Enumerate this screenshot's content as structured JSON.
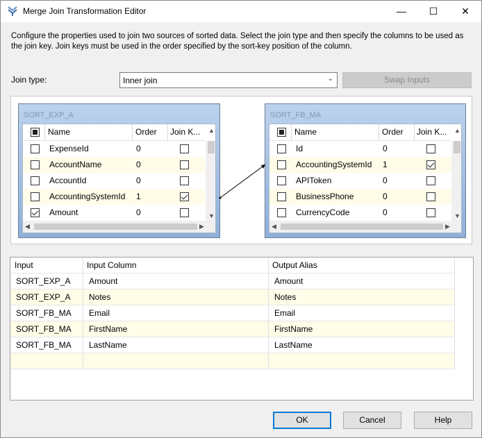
{
  "window": {
    "title": "Merge Join Transformation Editor",
    "minimize": "—",
    "maximize": "☐",
    "close": "✕"
  },
  "description": "Configure the properties used to join two sources of sorted data. Select the join type and then specify the columns to be used as the join key. Join keys must be used in the order specified by the sort-key position of the column.",
  "join": {
    "label": "Join type:",
    "selected": "Inner join",
    "swap_label": "Swap Inputs"
  },
  "left_source": {
    "name": "SORT_EXP_A",
    "columns": [
      "Name",
      "Order",
      "Join K..."
    ],
    "rows": [
      {
        "name": "ExpenseId",
        "order": "0",
        "selected": false,
        "join_key": false
      },
      {
        "name": "AccountName",
        "order": "0",
        "selected": false,
        "join_key": false
      },
      {
        "name": "AccountId",
        "order": "0",
        "selected": false,
        "join_key": false
      },
      {
        "name": "AccountingSystemId",
        "order": "1",
        "selected": false,
        "join_key": true
      },
      {
        "name": "Amount",
        "order": "0",
        "selected": true,
        "join_key": false
      }
    ]
  },
  "right_source": {
    "name": "SORT_FB_MA",
    "columns": [
      "Name",
      "Order",
      "Join K..."
    ],
    "rows": [
      {
        "name": "Id",
        "order": "0",
        "selected": false,
        "join_key": false
      },
      {
        "name": "AccountingSystemId",
        "order": "1",
        "selected": false,
        "join_key": true
      },
      {
        "name": "APIToken",
        "order": "0",
        "selected": false,
        "join_key": false
      },
      {
        "name": "BusinessPhone",
        "order": "0",
        "selected": false,
        "join_key": false
      },
      {
        "name": "CurrencyCode",
        "order": "0",
        "selected": false,
        "join_key": false
      }
    ]
  },
  "output": {
    "headers": [
      "Input",
      "Input Column",
      "Output Alias"
    ],
    "rows": [
      [
        "SORT_EXP_A",
        "Amount",
        "Amount"
      ],
      [
        "SORT_EXP_A",
        "Notes",
        "Notes"
      ],
      [
        "SORT_FB_MA",
        "Email",
        "Email"
      ],
      [
        "SORT_FB_MA",
        "FirstName",
        "FirstName"
      ],
      [
        "SORT_FB_MA",
        "LastName",
        "LastName"
      ]
    ]
  },
  "buttons": {
    "ok": "OK",
    "cancel": "Cancel",
    "help": "Help"
  }
}
